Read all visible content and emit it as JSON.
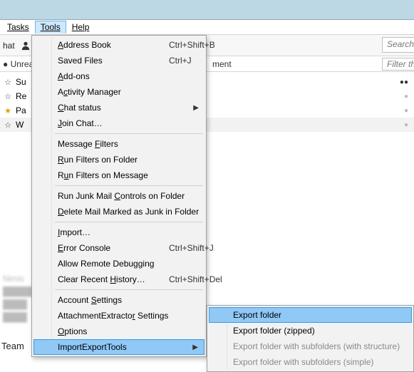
{
  "menubar": {
    "tasks": "Tasks",
    "tools": "Tools",
    "help": "Help"
  },
  "toolbar": {
    "chat_frag": "hat",
    "search_placeholder": "Search"
  },
  "header": {
    "unread_frag": "●  Unrea",
    "ment_frag": "ment",
    "filter_placeholder": "Filter th"
  },
  "rows": {
    "r0": "Su",
    "r1": "Re",
    "r2": "Pa",
    "r3": "W"
  },
  "team_frag": "Team",
  "tools_menu": {
    "address_book": "Address Book",
    "address_book_sc": "Ctrl+Shift+B",
    "saved_files": "Saved Files",
    "saved_files_sc": "Ctrl+J",
    "addons": "Add-ons",
    "activity_manager": "Activity Manager",
    "chat_status": "Chat status",
    "join_chat": "Join Chat…",
    "message_filters": "Message Filters",
    "run_filters_folder": "Run Filters on Folder",
    "run_filters_message": "Run Filters on Message",
    "run_junk": "Run Junk Mail Controls on Folder",
    "delete_junk": "Delete Mail Marked as Junk in Folder",
    "import": "Import…",
    "error_console": "Error Console",
    "error_console_sc": "Ctrl+Shift+J",
    "allow_remote": "Allow Remote Debugging",
    "clear_history": "Clear Recent History…",
    "clear_history_sc": "Ctrl+Shift+Del",
    "account_settings": "Account Settings",
    "attachment_extractor": "AttachmentExtractor Settings",
    "options": "Options",
    "import_export_tools": "ImportExportTools"
  },
  "submenu": {
    "export_folder": "Export folder",
    "export_zipped": "Export folder (zipped)",
    "export_structure": "Export folder with subfolders (with structure)",
    "export_simple": "Export folder with subfolders (simple)"
  }
}
